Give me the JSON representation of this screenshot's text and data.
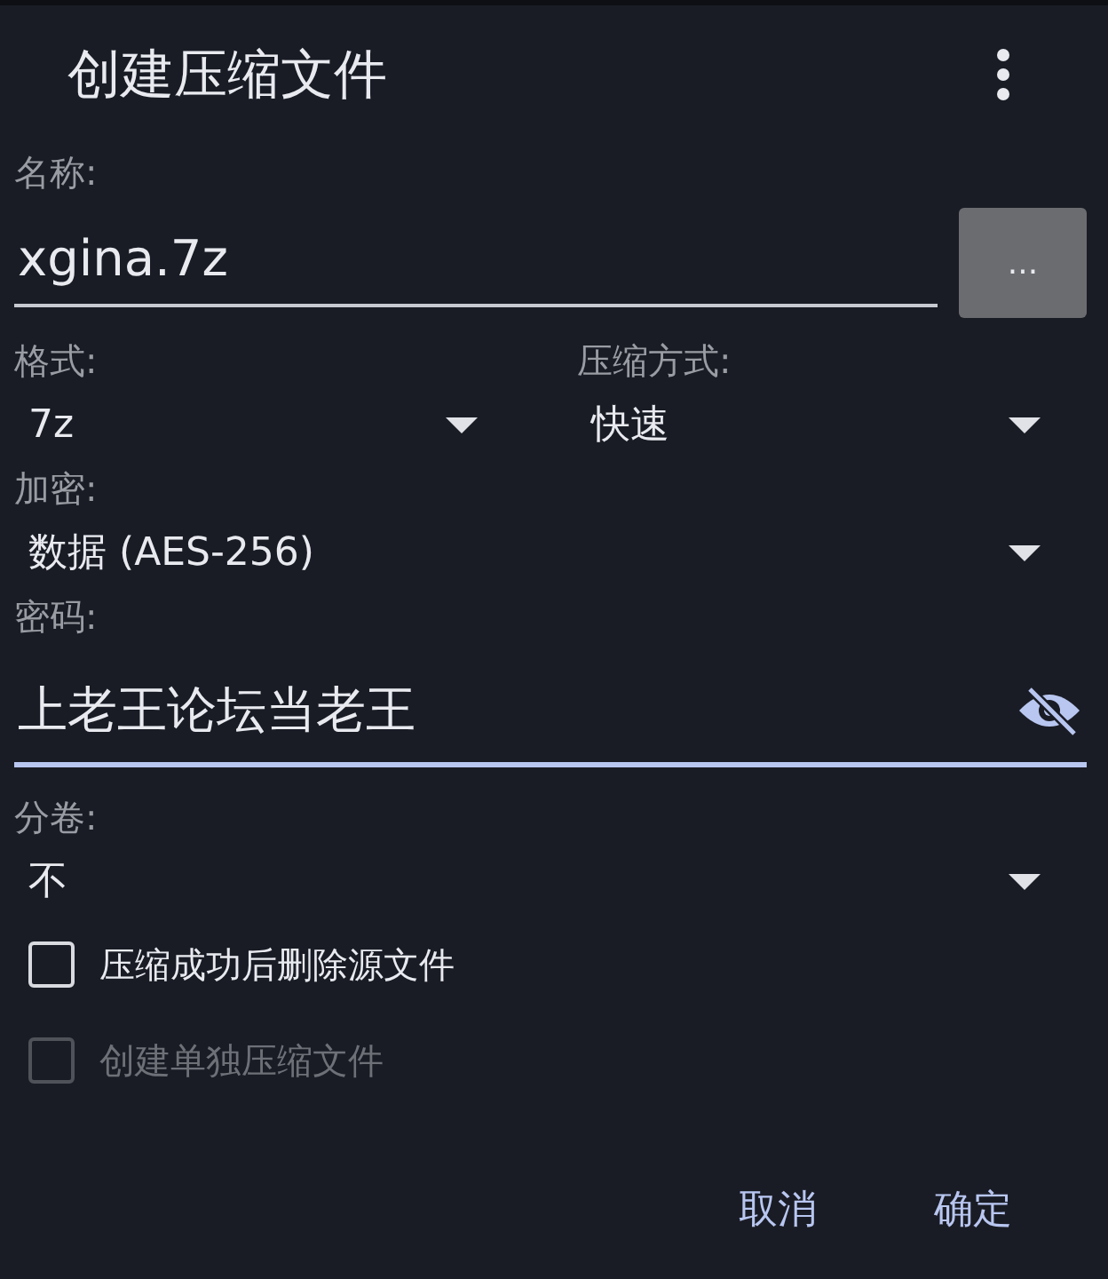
{
  "dialog": {
    "title": "创建压缩文件"
  },
  "name_field": {
    "label": "名称:",
    "value": "xgina.7z",
    "browse_button": "..."
  },
  "format_row": [
    {
      "label": "格式:",
      "value": "7z"
    },
    {
      "label": "压缩方式:",
      "value": "快速"
    }
  ],
  "encryption": {
    "label": "加密:",
    "value": "数据 (AES-256)"
  },
  "password_field": {
    "label": "密码:",
    "value": "上老王论坛当老王"
  },
  "split": {
    "label": "分卷:",
    "value": "不"
  },
  "options": [
    {
      "label": "压缩成功后删除源文件",
      "checked": false,
      "disabled": false
    },
    {
      "label": "创建单独压缩文件",
      "checked": false,
      "disabled": true
    }
  ],
  "buttons": [
    {
      "label": "取消"
    },
    {
      "label": "确定"
    }
  ]
}
